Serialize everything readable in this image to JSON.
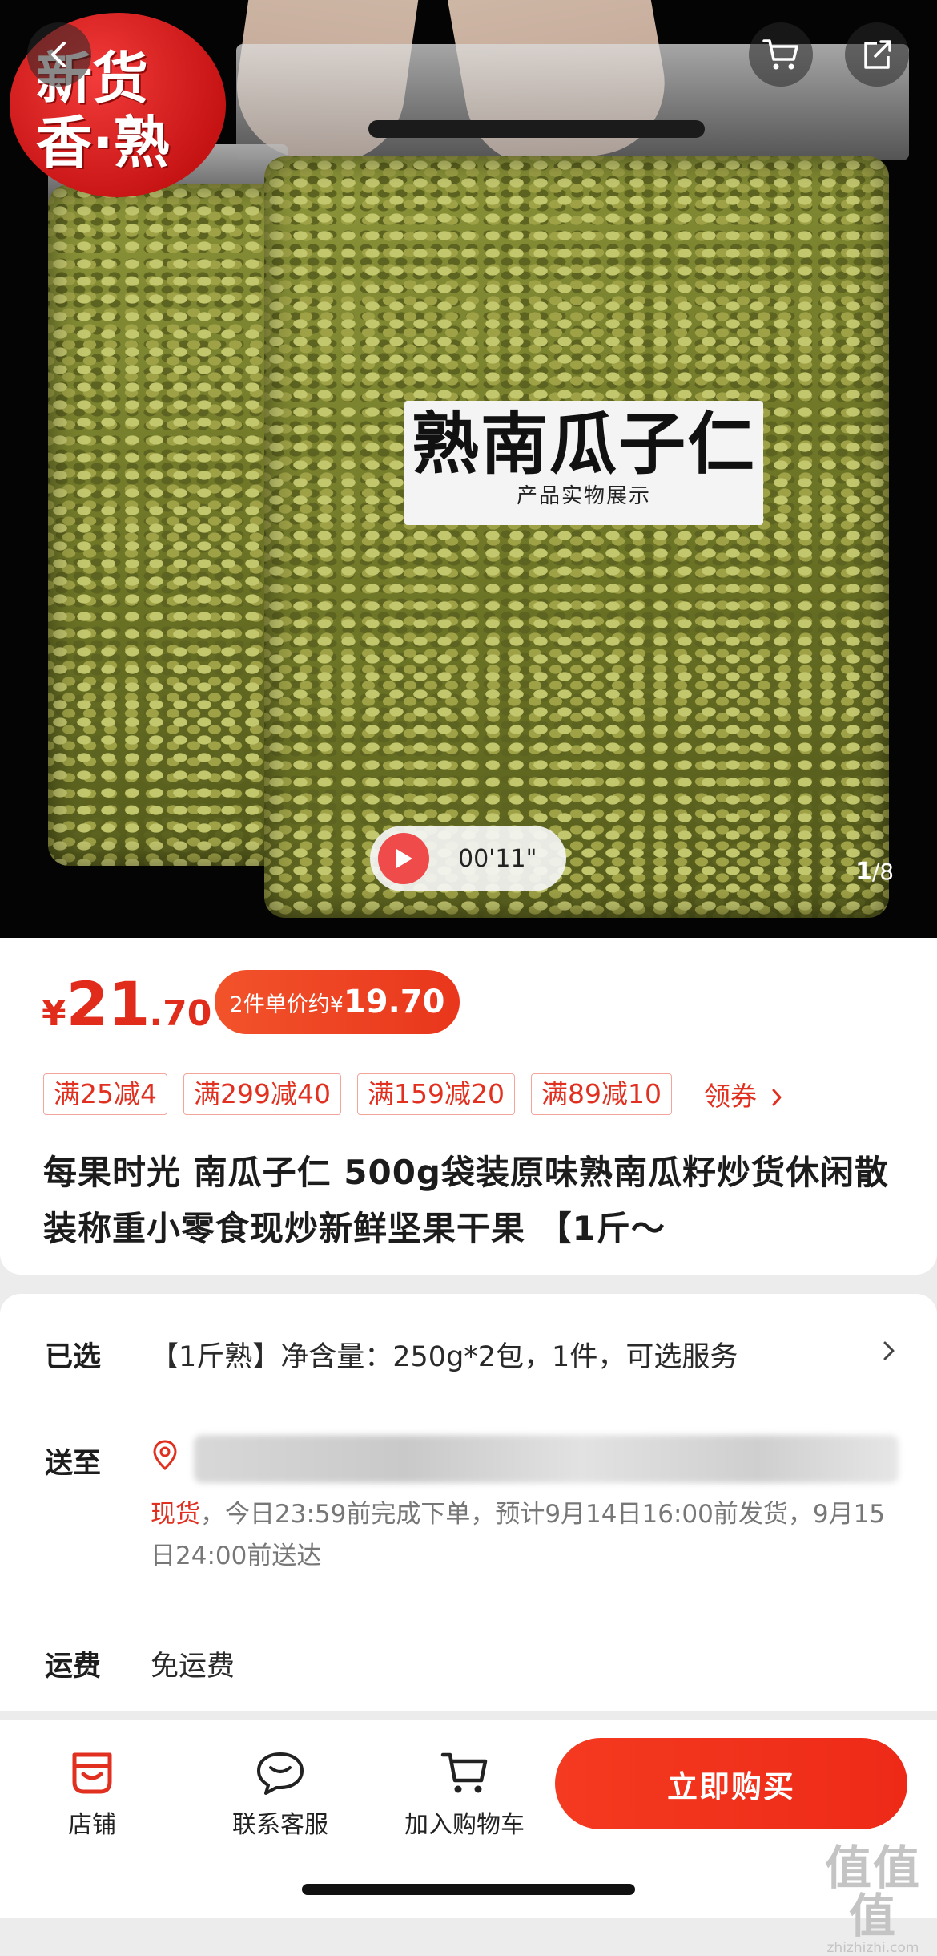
{
  "hero": {
    "badge_line1": "新货",
    "badge_line2": "香·熟",
    "label_title": "熟南瓜子仁",
    "label_sub": "产品实物展示",
    "video_time": "00'11\"",
    "page_current": "1",
    "page_total": "/8"
  },
  "price": {
    "currency": "¥",
    "integer": "21",
    "decimal": ".70",
    "multi_label": "2件单价约¥",
    "multi_value": "19.70"
  },
  "coupons": [
    "满25减4",
    "满299减40",
    "满159减20",
    "满89减10"
  ],
  "coupon_get_label": "领券",
  "title": "每果时光 南瓜子仁 500g袋装原味熟南瓜籽炒货休闲散装称重小零食现炒新鲜坚果干果 【1斤～",
  "options": {
    "selected_label": "已选",
    "selected_value": "【1斤熟】净含量：250g*2包，1件，可选服务",
    "ship_label": "送至",
    "stock_text": "现货",
    "ship_note": "，今日23:59前完成下单，预计9月14日16:00前发货，9月15日24:00前送达",
    "fee_label": "运费",
    "fee_value": "免运费"
  },
  "bottom": {
    "shop_label": "店铺",
    "service_label": "联系客服",
    "cart_label": "加入购物车",
    "buy_label": "立即购买"
  },
  "watermark": {
    "big": "值值值",
    "small": "zhizhizhi.com"
  },
  "colors": {
    "accent": "#e1301f",
    "buy_button": "#f43a20"
  },
  "icons": [
    "back-icon",
    "cart-icon",
    "share-icon",
    "play-icon",
    "location-icon",
    "chevron-right-icon",
    "shop-icon",
    "service-icon",
    "add-cart-icon"
  ]
}
